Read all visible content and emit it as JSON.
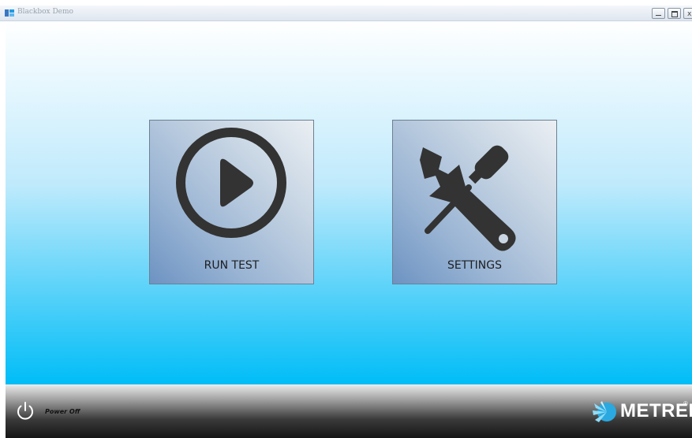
{
  "window": {
    "title": "Blackbox Demo",
    "controls": [
      "minimize-icon",
      "maximize-icon",
      "close-icon"
    ]
  },
  "tiles": [
    {
      "label": "RUN TEST",
      "icon": "play-circle-icon"
    },
    {
      "label": "SETTINGS",
      "icon": "wrench-screwdriver-icon"
    }
  ],
  "footer": {
    "power_label": "Power Off",
    "power_icon": "power-icon",
    "brand": "METREL",
    "brand_mark": "®"
  },
  "colors": {
    "background_top": "#ffffff",
    "background_bottom": "#00bdf7",
    "icon": "#333333",
    "footer_dark": "#151515"
  }
}
